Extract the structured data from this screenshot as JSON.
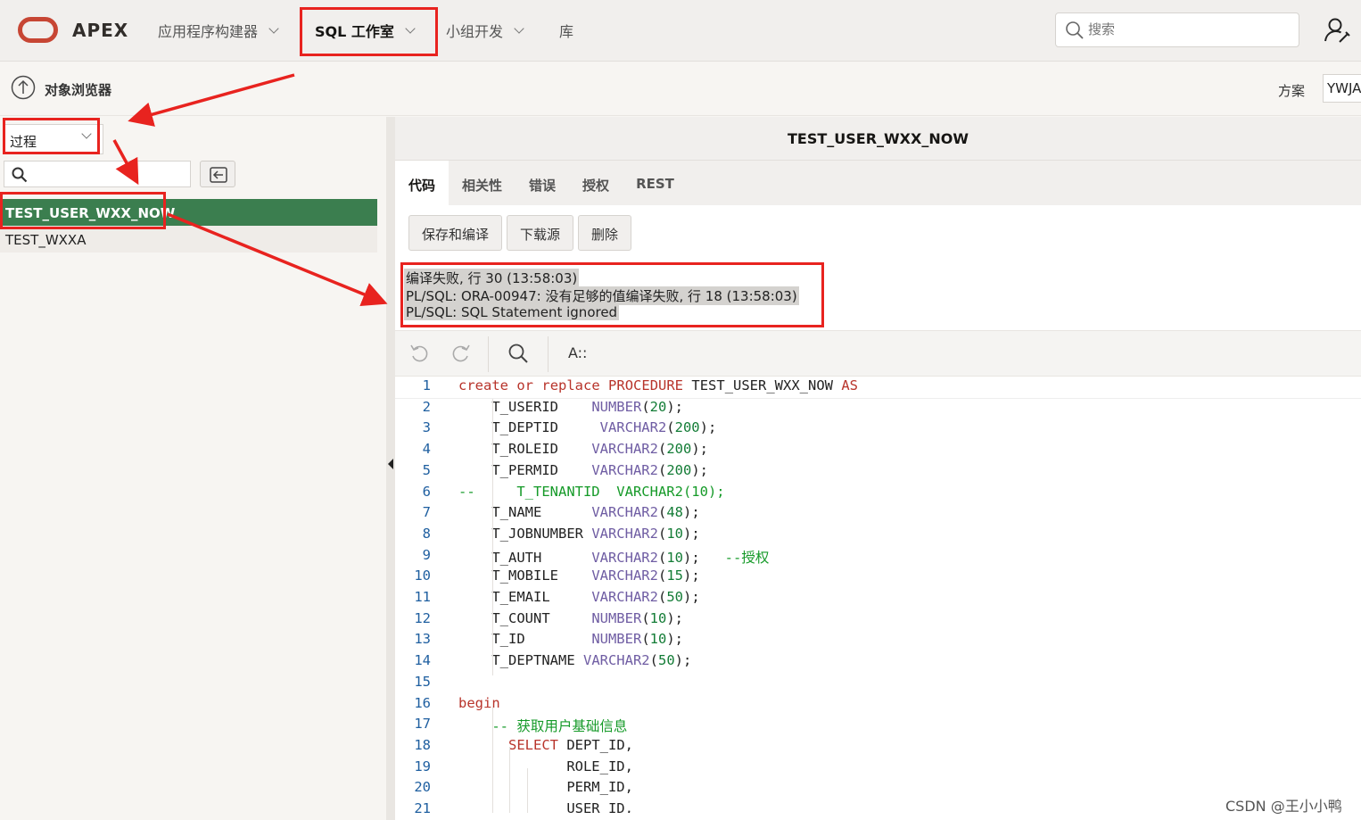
{
  "header": {
    "brand": "APEX",
    "nav": [
      {
        "label": "应用程序构建器",
        "has_menu": true
      },
      {
        "label": "SQL 工作室",
        "has_menu": true,
        "active": true
      },
      {
        "label": "小组开发",
        "has_menu": true
      },
      {
        "label": "库",
        "has_menu": false
      }
    ],
    "search_placeholder": "搜索",
    "icons": {
      "logo": "oracle-logo",
      "search": "search-icon",
      "user": "user-settings-icon"
    }
  },
  "subheader": {
    "title": "对象浏览器",
    "schema_label": "方案",
    "schema_value": "YWJA"
  },
  "left": {
    "object_type": "过程",
    "filter_placeholder": "",
    "objects": [
      {
        "name": "TEST_USER_WXX_NOW",
        "selected": true
      },
      {
        "name": "TEST_WXXA",
        "selected": false
      }
    ]
  },
  "right": {
    "object_name": "TEST_USER_WXX_NOW",
    "tabs": [
      "代码",
      "相关性",
      "错误",
      "授权",
      "REST"
    ],
    "active_tab": "代码",
    "buttons": {
      "save_compile": "保存和编译",
      "download": "下载源",
      "delete": "删除"
    },
    "messages": [
      "编译失败, 行 30 (13:58:03)",
      "PL/SQL: ORA-00947: 没有足够的值编译失败, 行 18 (13:58:03)",
      "PL/SQL: SQL Statement ignored"
    ],
    "editor_toolbar": {
      "undo": "undo-icon",
      "redo": "redo-icon",
      "find": "search-icon",
      "font": "A::"
    }
  },
  "code_lines": [
    "create or replace PROCEDURE TEST_USER_WXX_NOW AS",
    "    T_USERID    NUMBER(20);",
    "    T_DEPTID     VARCHAR2(200);",
    "    T_ROLEID    VARCHAR2(200);",
    "    T_PERMID    VARCHAR2(200);",
    "--     T_TENANTID  VARCHAR2(10);",
    "    T_NAME      VARCHAR2(48);",
    "    T_JOBNUMBER VARCHAR2(10);",
    "    T_AUTH      VARCHAR2(10);   --授权",
    "    T_MOBILE    VARCHAR2(15);",
    "    T_EMAIL     VARCHAR2(50);",
    "    T_COUNT     NUMBER(10);",
    "    T_ID        NUMBER(10);",
    "    T_DEPTNAME VARCHAR2(50);",
    "",
    "begin",
    "    -- 获取用户基础信息",
    "      SELECT DEPT_ID,",
    "             ROLE_ID,",
    "             PERM_ID,",
    "             USER_ID,"
  ],
  "watermark": "CSDN @王小小鸭",
  "colors": {
    "accent_red": "#e8231f",
    "selected_green": "#3b7e4f",
    "keyword": "#b8342b",
    "type": "#6f5da3",
    "number": "#137c36",
    "comment": "#159a28"
  }
}
